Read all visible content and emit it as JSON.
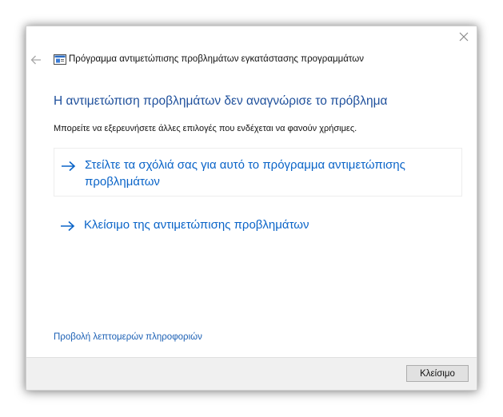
{
  "window": {
    "title": "Πρόγραμμα αντιμετώπισης προβλημάτων εγκατάστασης προγραμμάτων",
    "icons": {
      "back": "back-arrow-icon",
      "close": "close-icon",
      "app": "troubleshooter-app-icon"
    }
  },
  "content": {
    "heading": "Η αντιμετώπιση προβλημάτων δεν αναγνώρισε το πρόβλημα",
    "subtext": "Μπορείτε να εξερευνήσετε άλλες επιλογές που ενδέχεται να φανούν χρήσιμες.",
    "options": [
      {
        "label": "Στείλτε τα σχόλιά σας για αυτό το πρόγραμμα αντιμετώπισης προβλημάτων",
        "icon": "right-arrow-icon"
      },
      {
        "label": "Κλείσιμο της αντιμετώπισης προβλημάτων",
        "icon": "right-arrow-icon"
      }
    ],
    "details_link": "Προβολή λεπτομερών πληροφοριών"
  },
  "footer": {
    "close_button": "Κλείσιμο"
  },
  "colors": {
    "heading": "#1e4f9b",
    "link": "#0a64c8",
    "footer_bg": "#f0f0f0"
  }
}
